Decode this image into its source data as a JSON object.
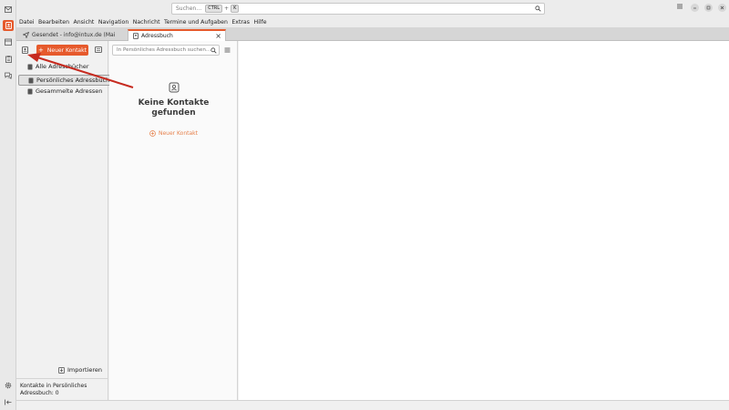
{
  "titlebar": {
    "search_placeholder": "Suchen…",
    "shortcut_key1": "CTRL",
    "shortcut_plus": "+",
    "shortcut_key2": "K"
  },
  "menubar": [
    "Datei",
    "Bearbeiten",
    "Ansicht",
    "Navigation",
    "Nachricht",
    "Termine und Aufgaben",
    "Extras",
    "Hilfe"
  ],
  "tabs": [
    {
      "label": "Gesendet - info@intux.de (Mai",
      "active": false
    },
    {
      "label": "Adressbuch",
      "active": true
    }
  ],
  "sidebar": {
    "new_contact_label": "Neuer Kontakt",
    "books": [
      {
        "label": "Alle Adressbücher"
      },
      {
        "label": "Persönliches Adressbuch"
      },
      {
        "label": "Gesammelte Adressen"
      }
    ],
    "import_label": "Importieren",
    "footer_text": "Kontakte in Persönliches Adressbuch: 0"
  },
  "list": {
    "search_placeholder": "In Persönliches Adressbuch suchen…",
    "empty_title": "Keine Kontakte gefunden",
    "empty_new_contact": "Neuer Kontakt"
  },
  "colors": {
    "accent": "#e65a2c",
    "annotation_arrow": "#c62a1f"
  }
}
